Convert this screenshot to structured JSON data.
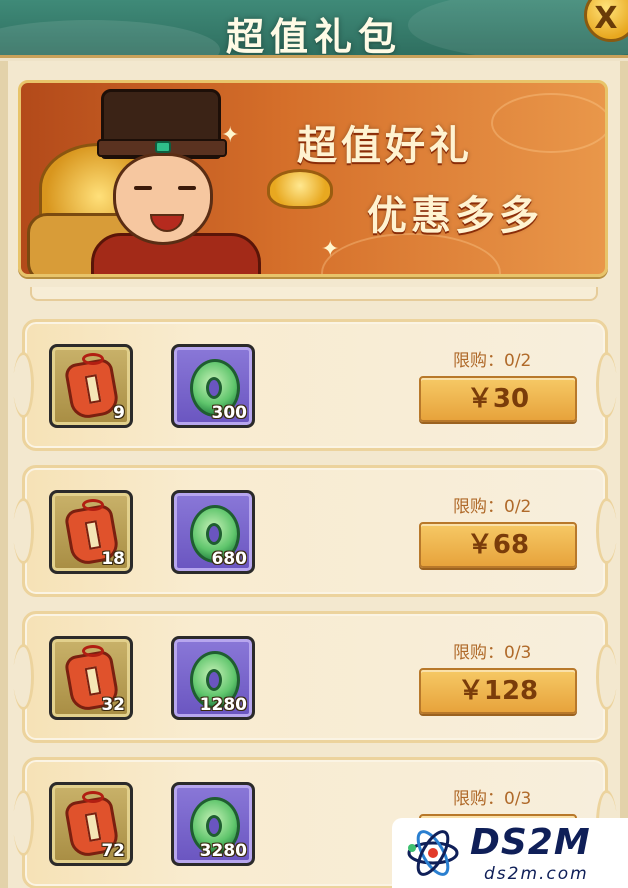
{
  "header": {
    "title": "超值礼包",
    "close_glyph": "X"
  },
  "banner": {
    "title": "超值好礼",
    "subtitle": "优惠多多"
  },
  "offers": [
    {
      "pouch_qty": "9",
      "jade_qty": "300",
      "limit": "限购：0/2",
      "price": "￥30"
    },
    {
      "pouch_qty": "18",
      "jade_qty": "680",
      "limit": "限购：0/2",
      "price": "￥68"
    },
    {
      "pouch_qty": "32",
      "jade_qty": "1280",
      "limit": "限购：0/3",
      "price": "￥128"
    },
    {
      "pouch_qty": "72",
      "jade_qty": "3280",
      "limit": "限购：0/3",
      "price": ""
    }
  ],
  "watermark": {
    "brand": "DS2M",
    "site": "ds2m.com"
  },
  "icons": {
    "pouch": "red-lucky-pouch-icon",
    "jade": "green-jade-pendant-icon",
    "close": "close-icon"
  },
  "colors": {
    "header": "#2f6f60",
    "price_button": "#e7a33c",
    "limit_text": "#b06a2a"
  }
}
